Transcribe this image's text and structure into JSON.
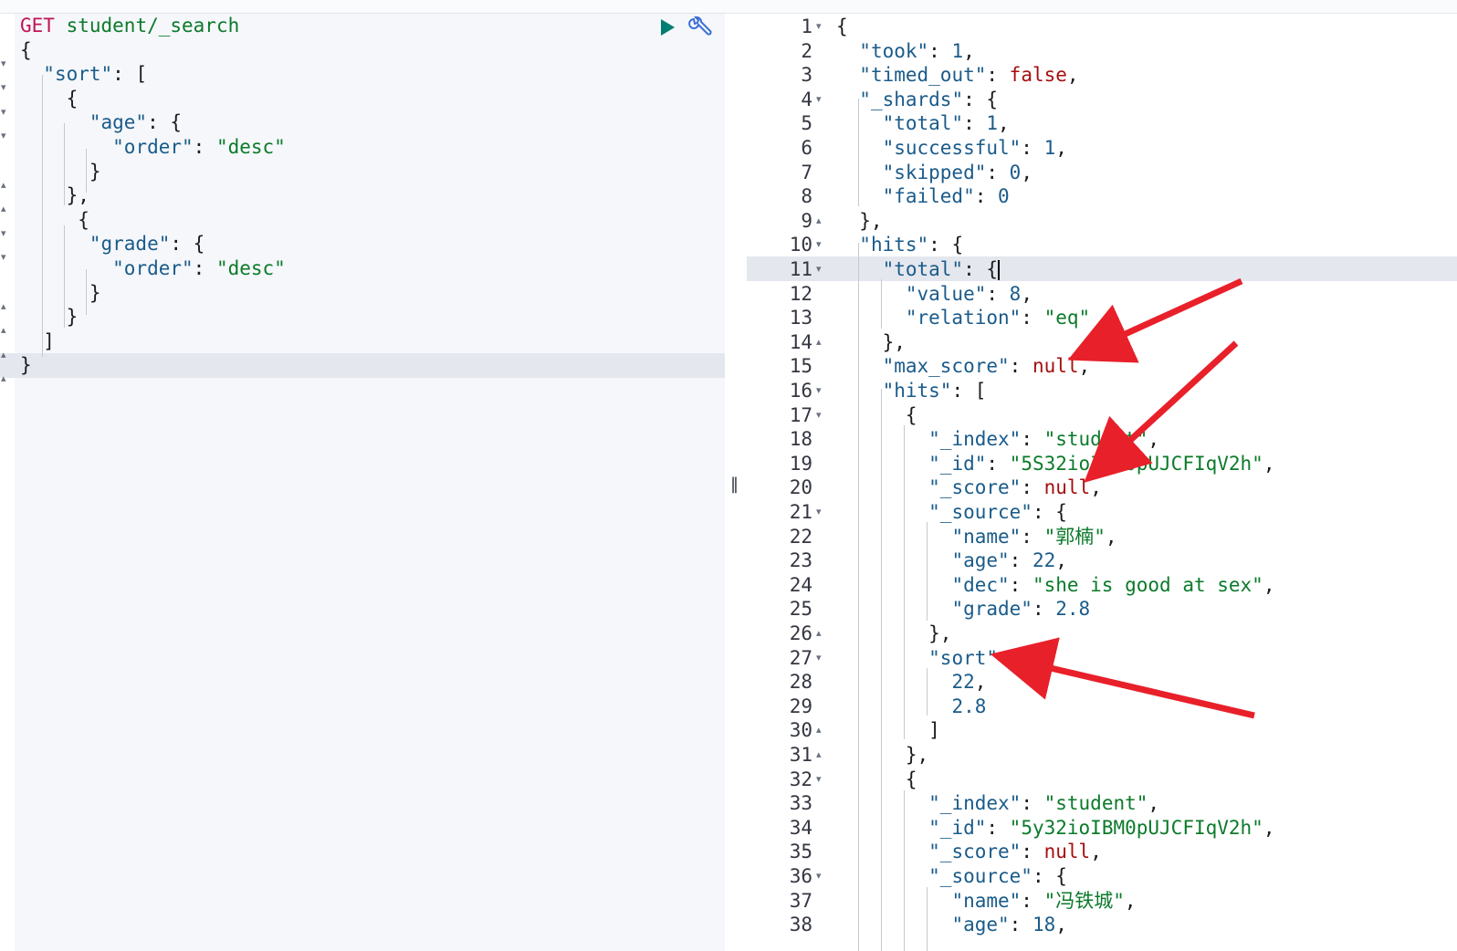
{
  "request": {
    "method": "GET",
    "path": "student/_search",
    "lines": [
      "{",
      "  \"sort\": [",
      "    {",
      "      \"age\": {",
      "        \"order\": \"desc\"",
      "      }",
      "    },",
      "     {",
      "      \"grade\": {",
      "        \"order\": \"desc\"",
      "      }",
      "    }",
      "  ]",
      "}"
    ]
  },
  "response": {
    "line_numbers": [
      "1",
      "2",
      "3",
      "4",
      "5",
      "6",
      "7",
      "8",
      "9",
      "10",
      "11",
      "12",
      "13",
      "14",
      "15",
      "16",
      "17",
      "18",
      "19",
      "20",
      "21",
      "22",
      "23",
      "24",
      "25",
      "26",
      "27",
      "28",
      "29",
      "30",
      "31",
      "32",
      "33",
      "34",
      "35",
      "36",
      "37",
      "38"
    ],
    "lines": [
      "{",
      "  \"took\": 1,",
      "  \"timed_out\": false,",
      "  \"_shards\": {",
      "    \"total\": 1,",
      "    \"successful\": 1,",
      "    \"skipped\": 0,",
      "    \"failed\": 0",
      "  },",
      "  \"hits\": {",
      "    \"total\": {",
      "      \"value\": 8,",
      "      \"relation\": \"eq\"",
      "    },",
      "    \"max_score\": null,",
      "    \"hits\": [",
      "      {",
      "        \"_index\": \"student\",",
      "        \"_id\": \"5S32ioIBM0pUJCFIqV2h\",",
      "        \"_score\": null,",
      "        \"_source\": {",
      "          \"name\": \"郭楠\",",
      "          \"age\": 22,",
      "          \"dec\": \"she is good at sex\",",
      "          \"grade\": 2.8",
      "        },",
      "        \"sort\": [",
      "          22,",
      "          2.8",
      "        ]",
      "      },",
      "      {",
      "        \"_index\": \"student\",",
      "        \"_id\": \"5y32ioIBM0pUJCFIqV2h\",",
      "        \"_score\": null,",
      "        \"_source\": {",
      "          \"name\": \"冯铁城\",",
      "          \"age\": 18,"
    ]
  },
  "splitter_glyph": "‖",
  "colors": {
    "key": "#1a5b8a",
    "string": "#0b7a2a",
    "bool_null": "#a40f0f",
    "method": "#c0155a",
    "run": "#017d73",
    "arrow": "#e8202a"
  }
}
